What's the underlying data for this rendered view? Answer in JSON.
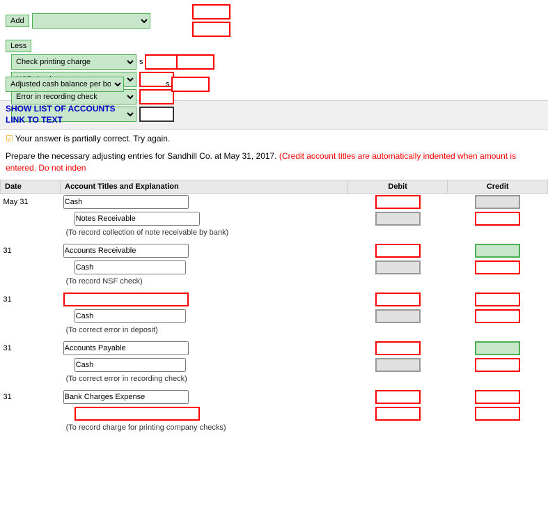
{
  "top": {
    "add_label": "Add",
    "less_label": "Less",
    "items": [
      {
        "name": "Check printing charge",
        "amount": ""
      },
      {
        "name": "NSF check",
        "amount": ""
      },
      {
        "name": "Error in recording check",
        "amount": ""
      },
      {
        "name": "",
        "amount": ""
      }
    ],
    "sub_total_1": "",
    "sub_total_2": "",
    "adjusted_label": "Adjusted cash balance per books",
    "adjusted_s": "s",
    "adjusted_amount": "",
    "add_amount_1": "",
    "add_amount_2": ""
  },
  "links": {
    "show_list": "SHOW LIST OF ACCOUNTS",
    "link_to_text": "LINK TO TEXT"
  },
  "feedback": {
    "icon": "☑",
    "text": "Your answer is partially correct.  Try again."
  },
  "question": {
    "text": "Prepare the necessary adjusting entries for Sandhill Co. at May 31, 2017.",
    "credit_note": "(Credit account titles are automatically indented when amount is entered. Do not inden"
  },
  "table": {
    "headers": [
      "Date",
      "Account Titles and Explanation",
      "Debit",
      "Credit"
    ],
    "entries": [
      {
        "date": "May 31",
        "account1": "Cash",
        "account2": "Notes Receivable",
        "explanation": "(To record collection of note receivable by bank)",
        "debit1_type": "red",
        "credit1_type": "gray",
        "debit2_type": "gray",
        "credit2_type": "red",
        "indented": false
      },
      {
        "date": "31",
        "account1": "Accounts Receivable",
        "account2": "Cash",
        "explanation": "(To record NSF check)",
        "debit1_type": "red",
        "credit1_type": "green",
        "debit2_type": "gray",
        "credit2_type": "red",
        "indented": true
      },
      {
        "date": "31",
        "account1": "",
        "account2": "Cash",
        "explanation": "(To correct error in deposit)",
        "debit1_type": "red",
        "credit1_type": "red",
        "debit2_type": "gray",
        "credit2_type": "red",
        "indented": false,
        "account1_empty": true
      },
      {
        "date": "31",
        "account1": "Accounts Payable",
        "account2": "Cash",
        "explanation": "(To correct error in recording check)",
        "debit1_type": "red",
        "credit1_type": "green",
        "debit2_type": "gray",
        "credit2_type": "red",
        "indented": true
      },
      {
        "date": "31",
        "account1": "Bank Charges Expense",
        "account2": "",
        "explanation": "(To record charge for printing company checks)",
        "debit1_type": "red",
        "credit1_type": "red",
        "debit2_type": "red",
        "credit2_type": "red",
        "indented": false,
        "account2_empty": true
      }
    ]
  }
}
